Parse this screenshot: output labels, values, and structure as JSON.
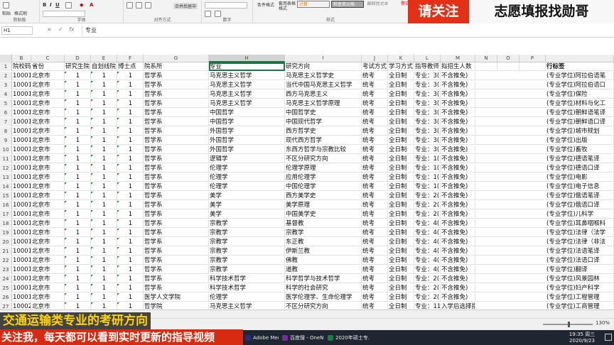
{
  "ribbon": {
    "clipboard_label": "剪贴板",
    "font_label": "字体",
    "align_label": "对齐方式",
    "number_label": "数字",
    "styles_label": "样式",
    "cells_label": "单元格",
    "editing_label": "编辑",
    "format_painter": "格式刷",
    "cut": "粘贴",
    "merge_center": "合并后居中",
    "conditional_format": "条件格式",
    "table_format": "套用表格格式",
    "style_calc": "计算",
    "style_check": "检查单元格",
    "style_explain": "解释性文本",
    "style_warn": "警告"
  },
  "banners": {
    "left": "请关注",
    "right": "志愿填报找勋哥"
  },
  "formula_bar": {
    "name_box": "H1",
    "cancel_symbol": "×",
    "confirm_symbol": "✓",
    "fx_symbol": "fx",
    "content": "专业"
  },
  "columns": [
    "B",
    "C",
    "D",
    "E",
    "F",
    "G",
    "H",
    "I",
    "J",
    "K",
    "L",
    "M",
    "N",
    "O",
    "P"
  ],
  "headers": [
    "院校码",
    "省份",
    "研究生院",
    "自划线院",
    "博士点",
    "院系所",
    "专业",
    "研究方向",
    "考试方式",
    "学习方式",
    "指导教师",
    "拟招生人数",
    "",
    "",
    "",
    "行标签"
  ],
  "rows": [
    [
      "10001",
      "北京市",
      "1",
      "1",
      "1",
      "哲学系",
      "马克思主义哲学",
      "马克思主义哲学史",
      "统考",
      "全日制",
      "专业：3(",
      "不含推免)",
      "(专业学位)阿拉伯语笔"
    ],
    [
      "10001",
      "北京市",
      "1",
      "1",
      "1",
      "哲学系",
      "马克思主义哲学",
      "当代中国马克思主义哲学",
      "统考",
      "全日制",
      "专业：3(",
      "不含推免)",
      "(专业学位)阿拉伯语口"
    ],
    [
      "10001",
      "北京市",
      "1",
      "1",
      "1",
      "哲学系",
      "马克思主义哲学",
      "西方马克思主义",
      "统考",
      "全日制",
      "专业：3(",
      "不含推免)",
      "(专业学位)保险"
    ],
    [
      "10001",
      "北京市",
      "1",
      "1",
      "1",
      "哲学系",
      "马克思主义哲学",
      "马克思主义哲学原理",
      "统考",
      "全日制",
      "专业：3(",
      "不含推免)",
      "(专业学位)材料与化工"
    ],
    [
      "10001",
      "北京市",
      "1",
      "1",
      "1",
      "哲学系",
      "中国哲学",
      "中国哲学史",
      "统考",
      "全日制",
      "专业：3(",
      "不含推免)",
      "(专业学位)朝鲜语笔译"
    ],
    [
      "10001",
      "北京市",
      "1",
      "1",
      "1",
      "哲学系",
      "中国哲学",
      "中国现代哲学",
      "统考",
      "全日制",
      "专业：3(",
      "不含推免)",
      "(专业学位)朝鲜语口译"
    ],
    [
      "10001",
      "北京市",
      "1",
      "1",
      "1",
      "哲学系",
      "外国哲学",
      "西方哲学史",
      "统考",
      "全日制",
      "专业：3(",
      "不含推免)",
      "(专业学位)城市规划"
    ],
    [
      "10001",
      "北京市",
      "1",
      "1",
      "1",
      "哲学系",
      "外国哲学",
      "现代西方哲学",
      "统考",
      "全日制",
      "专业：3(",
      "不含推免)",
      "(专业学位)出版"
    ],
    [
      "10001",
      "北京市",
      "1",
      "1",
      "1",
      "哲学系",
      "外国哲学",
      "东西方哲学与宗教比较",
      "统考",
      "全日制",
      "专业：3(",
      "不含推免)",
      "(专业学位)畜牧"
    ],
    [
      "10001",
      "北京市",
      "1",
      "1",
      "1",
      "哲学系",
      "逻辑学",
      "不区分研究方向",
      "统考",
      "全日制",
      "专业：1(",
      "不含推免)",
      "(专业学位)德语笔译"
    ],
    [
      "10001",
      "北京市",
      "1",
      "1",
      "1",
      "哲学系",
      "伦理学",
      "伦理学原理",
      "统考",
      "全日制",
      "专业：1(",
      "不含推免)",
      "(专业学位)德语口译"
    ],
    [
      "10001",
      "北京市",
      "1",
      "1",
      "1",
      "哲学系",
      "伦理学",
      "应用伦理学",
      "统考",
      "全日制",
      "专业：1(",
      "不含推免)",
      "(专业学位)电影"
    ],
    [
      "10001",
      "北京市",
      "1",
      "1",
      "1",
      "哲学系",
      "伦理学",
      "中国伦理学",
      "统考",
      "全日制",
      "专业：1(",
      "不含推免)",
      "(专业学位)电子信息"
    ],
    [
      "10001",
      "北京市",
      "1",
      "1",
      "1",
      "哲学系",
      "美学",
      "西方美学史",
      "统考",
      "全日制",
      "专业：2(",
      "不含推免)",
      "(专业学位)俄语笔译"
    ],
    [
      "10001",
      "北京市",
      "1",
      "1",
      "1",
      "哲学系",
      "美学",
      "美学原理",
      "统考",
      "全日制",
      "专业：2(",
      "不含推免)",
      "(专业学位)俄语口译"
    ],
    [
      "10001",
      "北京市",
      "1",
      "1",
      "1",
      "哲学系",
      "美学",
      "中国美学史",
      "统考",
      "全日制",
      "专业：2(",
      "不含推免)",
      "(专业学位)儿科学"
    ],
    [
      "10001",
      "北京市",
      "1",
      "1",
      "1",
      "哲学系",
      "宗教学",
      "基督教",
      "统考",
      "全日制",
      "专业：4(",
      "不含推免)",
      "(专业学位)耳鼻咽喉科"
    ],
    [
      "10001",
      "北京市",
      "1",
      "1",
      "1",
      "哲学系",
      "宗教学",
      "宗教学",
      "统考",
      "全日制",
      "专业：4(",
      "不含推免)",
      "(专业学位)法律（法学"
    ],
    [
      "10001",
      "北京市",
      "1",
      "1",
      "1",
      "哲学系",
      "宗教学",
      "东正教",
      "统考",
      "全日制",
      "专业：4(",
      "不含推免)",
      "(专业学位)法律（非法"
    ],
    [
      "10001",
      "北京市",
      "1",
      "1",
      "1",
      "哲学系",
      "宗教学",
      "伊斯兰教",
      "统考",
      "全日制",
      "专业：4(",
      "不含推免)",
      "(专业学位)法语笔译"
    ],
    [
      "10001",
      "北京市",
      "1",
      "1",
      "1",
      "哲学系",
      "宗教学",
      "佛教",
      "统考",
      "全日制",
      "专业：4(",
      "不含推免)",
      "(专业学位)法语口译"
    ],
    [
      "10001",
      "北京市",
      "1",
      "1",
      "1",
      "哲学系",
      "宗教学",
      "道教",
      "统考",
      "全日制",
      "专业：4(",
      "不含推免)",
      "(专业学位)翻译"
    ],
    [
      "10001",
      "北京市",
      "1",
      "1",
      "1",
      "哲学系",
      "科学技术哲学",
      "科学哲学与技术哲学",
      "统考",
      "全日制",
      "专业：2(",
      "不含推免)",
      "(专业学位)风景园林"
    ],
    [
      "10001",
      "北京市",
      "1",
      "1",
      "1",
      "哲学系",
      "科学技术哲学",
      "科学的社会研究",
      "统考",
      "全日制",
      "专业：2(",
      "不含推免)",
      "(专业学位)妇产科学"
    ],
    [
      "10001",
      "北京市",
      "1",
      "1",
      "1",
      "医学人文学院",
      "伦理学",
      "医学伦理学、生命伦理学",
      "统考",
      "全日制",
      "专业：2(",
      "不含推免)",
      "(专业学位)工程管理"
    ],
    [
      "10002",
      "北京市",
      "1",
      "1",
      "1",
      "哲学院",
      "马克思主义哲学",
      "不区分研究方向",
      "统考",
      "全日制",
      "专业：11",
      "入学后选择指导教师",
      "(专业学位)工商管理"
    ]
  ],
  "status": {
    "zoom": "130%"
  },
  "taskbar": {
    "items": [
      "Adobe Media...",
      "百度搜 - OneN...",
      "2020年硕士专..."
    ],
    "time": "19:35 周三",
    "date": "2020/9/23"
  },
  "subtitles": {
    "top": "交通运输类专业的考研方向",
    "bottom": "关注我，每天都可以看到实时更新的指导视频"
  }
}
